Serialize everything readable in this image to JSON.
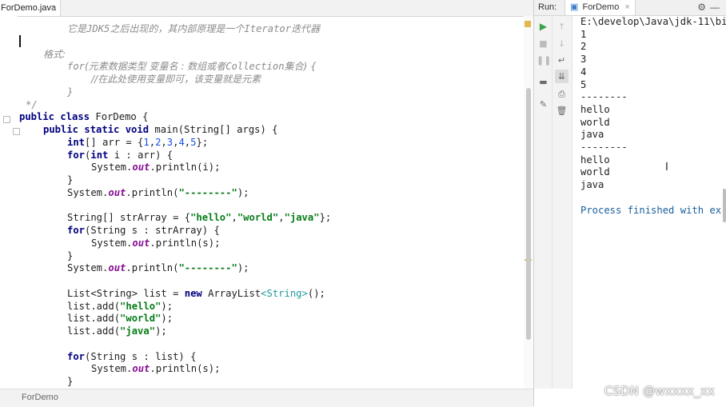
{
  "editor": {
    "tab_label": "ForDemo.java",
    "tab_close": "×",
    "status_label": "ForDemo",
    "lines": [
      [
        {
          "t": "它是",
          "c": "cmt-cn"
        },
        {
          "t": "JDK5",
          "c": "cmt"
        },
        {
          "t": "之后出现的，其内部原理是一个",
          "c": "cmt-cn"
        },
        {
          "t": "Iterator",
          "c": "cmt"
        },
        {
          "t": "迭代器",
          "c": "cmt-cn"
        }
      ],
      [],
      [
        {
          "t": "格式:",
          "c": "cmt-cn"
        }
      ],
      [
        {
          "t": "for",
          "c": "cmt"
        },
        {
          "t": "(元素数据类型 变量名 : 数组或者",
          "c": "cmt-cn"
        },
        {
          "t": "Collection",
          "c": "cmt"
        },
        {
          "t": "集合) {",
          "c": "cmt-cn"
        }
      ],
      [
        {
          "t": "//在此处使用变量即可，该变量就是元素",
          "c": "cmt-cn"
        }
      ],
      [
        {
          "t": "}",
          "c": "cmt"
        }
      ],
      [
        {
          "t": "*/",
          "c": "cmt"
        }
      ],
      [
        {
          "t": "public class ",
          "c": "kw"
        },
        {
          "t": "ForDemo {",
          "c": ""
        }
      ],
      [
        {
          "t": "public static void ",
          "c": "kw"
        },
        {
          "t": "main(String[] args) {",
          "c": ""
        }
      ],
      [
        {
          "t": "int",
          "c": "kw"
        },
        {
          "t": "[] arr = {",
          "c": ""
        },
        {
          "t": "1",
          "c": "num"
        },
        {
          "t": ",",
          "c": ""
        },
        {
          "t": "2",
          "c": "num"
        },
        {
          "t": ",",
          "c": ""
        },
        {
          "t": "3",
          "c": "num"
        },
        {
          "t": ",",
          "c": ""
        },
        {
          "t": "4",
          "c": "num"
        },
        {
          "t": ",",
          "c": ""
        },
        {
          "t": "5",
          "c": "num"
        },
        {
          "t": "};",
          "c": ""
        }
      ],
      [
        {
          "t": "for",
          "c": "kw"
        },
        {
          "t": "(",
          "c": ""
        },
        {
          "t": "int ",
          "c": "kw"
        },
        {
          "t": "i : arr) {",
          "c": ""
        }
      ],
      [
        {
          "t": "System.",
          "c": ""
        },
        {
          "t": "out",
          "c": "fld"
        },
        {
          "t": ".println(i);",
          "c": ""
        }
      ],
      [
        {
          "t": "}",
          "c": ""
        }
      ],
      [
        {
          "t": "System.",
          "c": ""
        },
        {
          "t": "out",
          "c": "fld"
        },
        {
          "t": ".println(",
          "c": ""
        },
        {
          "t": "\"--------\"",
          "c": "str"
        },
        {
          "t": ");",
          "c": ""
        }
      ],
      [],
      [
        {
          "t": "String[] strArray = {",
          "c": ""
        },
        {
          "t": "\"hello\"",
          "c": "str"
        },
        {
          "t": ",",
          "c": ""
        },
        {
          "t": "\"world\"",
          "c": "str"
        },
        {
          "t": ",",
          "c": ""
        },
        {
          "t": "\"java\"",
          "c": "str"
        },
        {
          "t": "};",
          "c": ""
        }
      ],
      [
        {
          "t": "for",
          "c": "kw"
        },
        {
          "t": "(String s : strArray) {",
          "c": ""
        }
      ],
      [
        {
          "t": "System.",
          "c": ""
        },
        {
          "t": "out",
          "c": "fld"
        },
        {
          "t": ".println(s);",
          "c": ""
        }
      ],
      [
        {
          "t": "}",
          "c": ""
        }
      ],
      [
        {
          "t": "System.",
          "c": ""
        },
        {
          "t": "out",
          "c": "fld"
        },
        {
          "t": ".println(",
          "c": ""
        },
        {
          "t": "\"--------\"",
          "c": "str"
        },
        {
          "t": ");",
          "c": ""
        }
      ],
      [],
      [
        {
          "t": "List<String> list = ",
          "c": ""
        },
        {
          "t": "new ",
          "c": "kw"
        },
        {
          "t": "ArrayList",
          "c": ""
        },
        {
          "t": "<String>",
          "c": "gen"
        },
        {
          "t": "();",
          "c": ""
        }
      ],
      [
        {
          "t": "list.add(",
          "c": ""
        },
        {
          "t": "\"hello\"",
          "c": "str"
        },
        {
          "t": ");",
          "c": ""
        }
      ],
      [
        {
          "t": "list.add(",
          "c": ""
        },
        {
          "t": "\"world\"",
          "c": "str"
        },
        {
          "t": ");",
          "c": ""
        }
      ],
      [
        {
          "t": "list.add(",
          "c": ""
        },
        {
          "t": "\"java\"",
          "c": "str"
        },
        {
          "t": ");",
          "c": ""
        }
      ],
      [],
      [
        {
          "t": "for",
          "c": "kw"
        },
        {
          "t": "(String s : list) {",
          "c": ""
        }
      ],
      [
        {
          "t": "System.",
          "c": ""
        },
        {
          "t": "out",
          "c": "fld"
        },
        {
          "t": ".println(s);",
          "c": ""
        }
      ],
      [
        {
          "t": "}",
          "c": ""
        }
      ]
    ]
  },
  "run_panel": {
    "label": "Run:",
    "tab_label": "ForDemo",
    "tab_close": "×",
    "gear_icon": "gear-icon",
    "minimize_icon": "minimize-icon",
    "console_lines": [
      "E:\\develop\\Java\\jdk-11\\bi",
      "1",
      "2",
      "3",
      "4",
      "5",
      "--------",
      "hello",
      "world",
      "java",
      "--------",
      "hello",
      "world",
      "java",
      "",
      "Process finished with ex"
    ]
  },
  "watermark": "CSDN @wxxxx_xx",
  "colors": {
    "keyword": "#000080",
    "string": "#067d17",
    "number": "#1750eb",
    "comment": "#8c8c8c",
    "field": "#871094",
    "run_green": "#3da34a",
    "finished_blue": "#1a5f9c"
  }
}
